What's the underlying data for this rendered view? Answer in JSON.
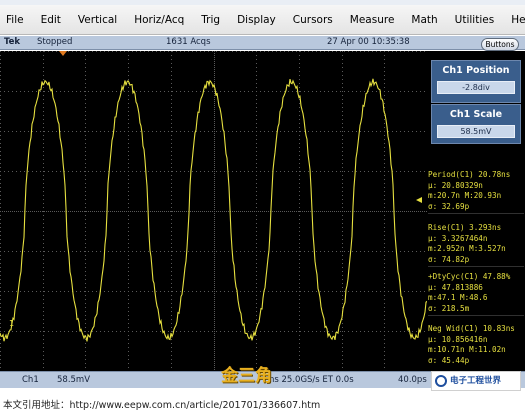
{
  "menu": {
    "items": [
      "File",
      "Edit",
      "Vertical",
      "Horiz/Acq",
      "Trig",
      "Display",
      "Cursors",
      "Measure",
      "Math",
      "Utilities",
      "Help"
    ]
  },
  "status": {
    "brand": "Tek",
    "state": "Stopped",
    "acqs": "1631 Acqs",
    "datetime": "27 Apr 00 10:35:38",
    "buttons_label": "Buttons"
  },
  "controls": {
    "position_title": "Ch1 Position",
    "position_value": "-2.8div",
    "scale_title": "Ch1 Scale",
    "scale_value": "58.5mV"
  },
  "measurements": [
    {
      "head": "Period(C1)  20.78ns",
      "lines": [
        "µ: 20.80329n",
        "m:20.7n   M:20.93n",
        "σ: 32.69p"
      ]
    },
    {
      "head": "Rise(C1)    3.293ns",
      "lines": [
        "µ: 3.3267464n",
        "m:2.952n  M:3.527n",
        "σ: 74.82p"
      ]
    },
    {
      "head": "+DtyCyc(C1) 47.88%",
      "lines": [
        "µ: 47.813886",
        "m:47.1      M:48.6",
        "σ: 218.5m"
      ]
    },
    {
      "head": "Neg Wid(C1) 10.83ns",
      "lines": [
        "µ: 10.856416n",
        "m:10.71n  M:11.02n",
        "σ: 45.44p"
      ]
    }
  ],
  "bottom": {
    "channel": "Ch1",
    "scale": "58.5mV",
    "timebase_fragment": "ns 25.0GS/s  ET  0.0s",
    "right_value": "40.0ps",
    "marker": "1"
  },
  "watermarks": {
    "cn": "金三角",
    "logo": "电子工程世界"
  },
  "caption": "本文引用地址：http://www.eepw.com.cn/article/201701/336607.htm",
  "colors": {
    "trace": "#e6e040",
    "grid": "#5a5a5a",
    "status_bg": "#b9c8dd",
    "panel_blue": "#3a5e8c"
  }
}
